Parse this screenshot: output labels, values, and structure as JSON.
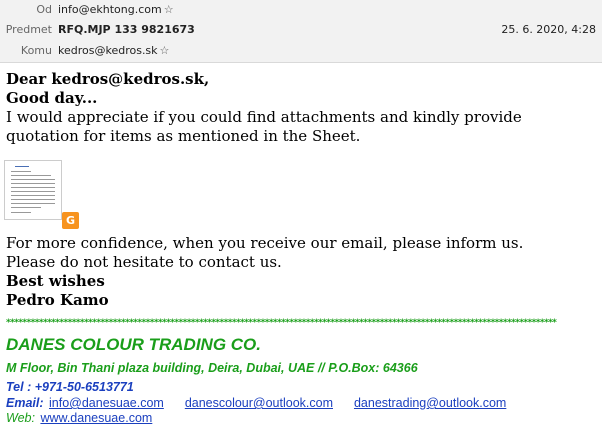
{
  "header": {
    "from_label": "Od",
    "from_value": "info@ekhtong.com",
    "subject_label": "Predmet",
    "subject_value": "RFQ.MJP 133 9821673",
    "date": "25. 6. 2020, 4:28",
    "to_label": "Komu",
    "to_value": "kedros@kedros.sk",
    "star_icon": "☆"
  },
  "message": {
    "greeting": "Dear kedros@kedros.sk,",
    "good_day": "Good day...",
    "para1": "I would appreciate if you could find attachments and kindly provide quotation for items as mentioned in the Sheet.",
    "attachment_badge": "G",
    "para2_line1": "For more confidence, when you receive our email, please inform us.",
    "para2_line2": "Please do not hesitate to contact us.",
    "closing": "Best wishes",
    "signer": "Pedro Kamo"
  },
  "signature": {
    "separator": "**************************************************************************************************************************************",
    "company": "DANES COLOUR TRADING CO.",
    "address": "M Floor, Bin Thani plaza building, Deira, Dubai, UAE // P.O.Box: 64366",
    "tel": "Tel : +971-50-6513771",
    "email_label": "Email:",
    "email1": "info@danesuae.com",
    "email2": "danescolour@outlook.com",
    "email3": "danestrading@outlook.com",
    "web_label": "Web:",
    "web": "www.danesuae.com"
  },
  "colors": {
    "green": "#1a9e1a",
    "link_blue": "#1a3fbf",
    "header_bg": "#f2f2f2"
  }
}
